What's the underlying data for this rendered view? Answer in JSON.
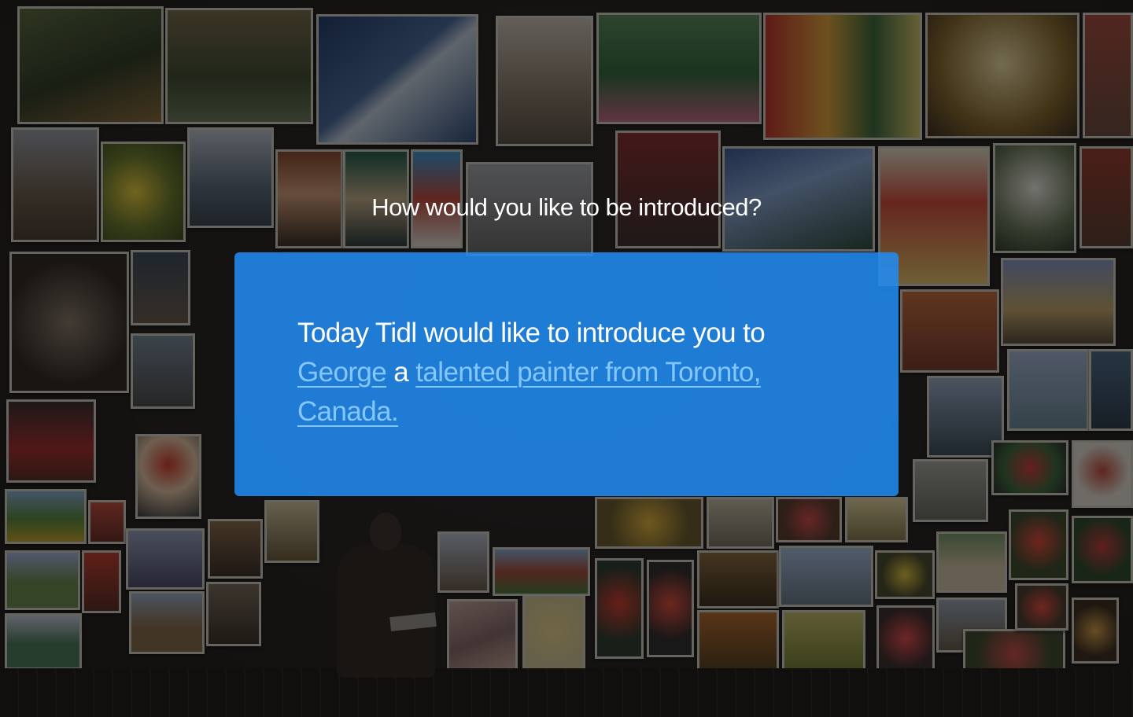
{
  "prompt": {
    "question": "How would you like to be introduced?"
  },
  "introduction": {
    "lead": "Today Tidl would like to introduce you to ",
    "name": "George",
    "connector": " a ",
    "description": "talented painter from Toronto, Canada."
  },
  "colors": {
    "card_blue": "#218DF5",
    "link_blue": "#84C6FF",
    "text_white": "#FFFFFF"
  }
}
